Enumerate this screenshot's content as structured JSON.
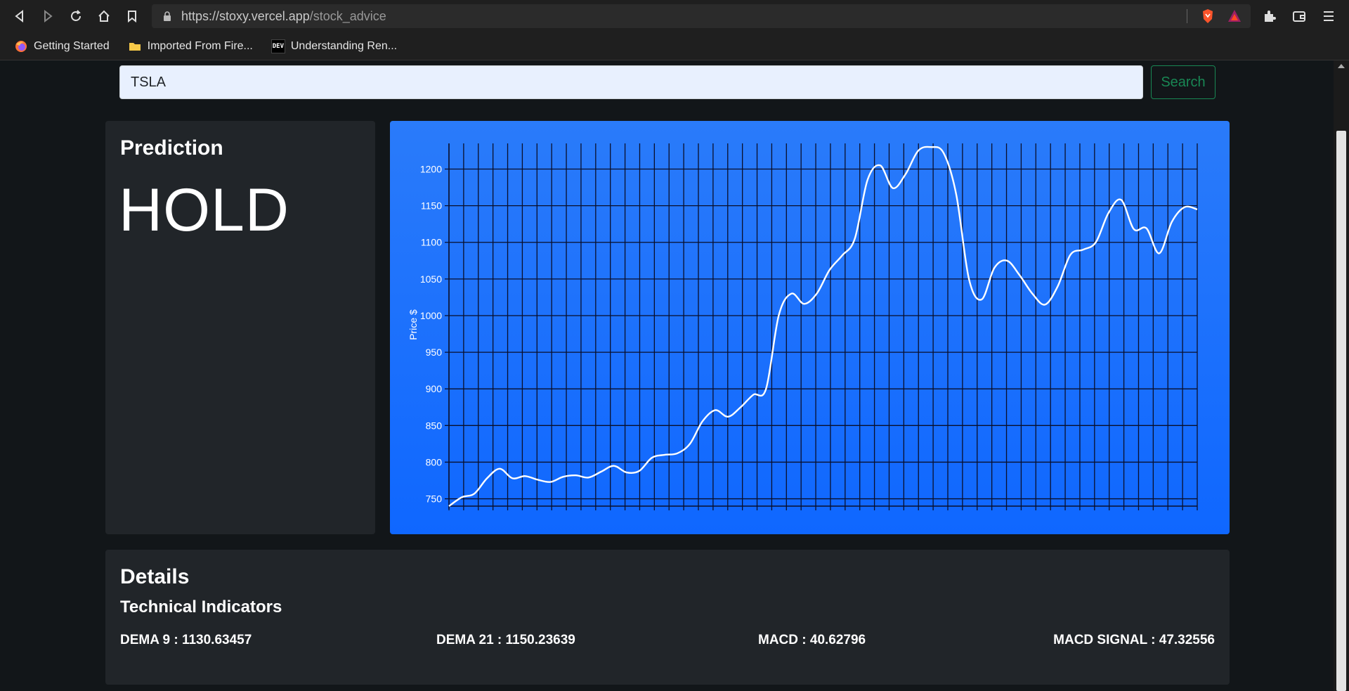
{
  "browser": {
    "url_domain": "https://stoxy.vercel.app",
    "url_path": "/stock_advice",
    "bookmarks": [
      {
        "label": "Getting Started",
        "icon": "firefox-icon"
      },
      {
        "label": "Imported From Fire...",
        "icon": "folder-icon"
      },
      {
        "label": "Understanding Ren...",
        "icon": "dev-icon",
        "badge": "DEV"
      }
    ]
  },
  "search": {
    "value": "TSLA",
    "button_label": "Search"
  },
  "prediction": {
    "title": "Prediction",
    "value": "HOLD"
  },
  "chart_data": {
    "type": "line",
    "ylabel": "Price $",
    "ylim": [
      740,
      1235
    ],
    "yticks": [
      750,
      800,
      850,
      900,
      950,
      1000,
      1050,
      1100,
      1150,
      1200
    ],
    "grid": true,
    "line_color": "#ffffff",
    "values": [
      740,
      752,
      757,
      778,
      791,
      778,
      781,
      776,
      773,
      780,
      782,
      779,
      787,
      795,
      786,
      788,
      806,
      810,
      812,
      825,
      856,
      871,
      862,
      875,
      892,
      900,
      1000,
      1030,
      1016,
      1030,
      1062,
      1082,
      1105,
      1185,
      1205,
      1174,
      1193,
      1225,
      1230,
      1222,
      1165,
      1050,
      1022,
      1065,
      1075,
      1055,
      1030,
      1015,
      1040,
      1083,
      1090,
      1100,
      1140,
      1158,
      1118,
      1119,
      1085,
      1128,
      1148,
      1145
    ]
  },
  "details": {
    "title": "Details",
    "subtitle": "Technical Indicators",
    "indicators": [
      {
        "label": "DEMA 9 : 1130.63457"
      },
      {
        "label": "DEMA 21 : 1150.23639"
      },
      {
        "label": "MACD : 40.62796"
      },
      {
        "label": "MACD SIGNAL : 47.32556"
      }
    ]
  }
}
